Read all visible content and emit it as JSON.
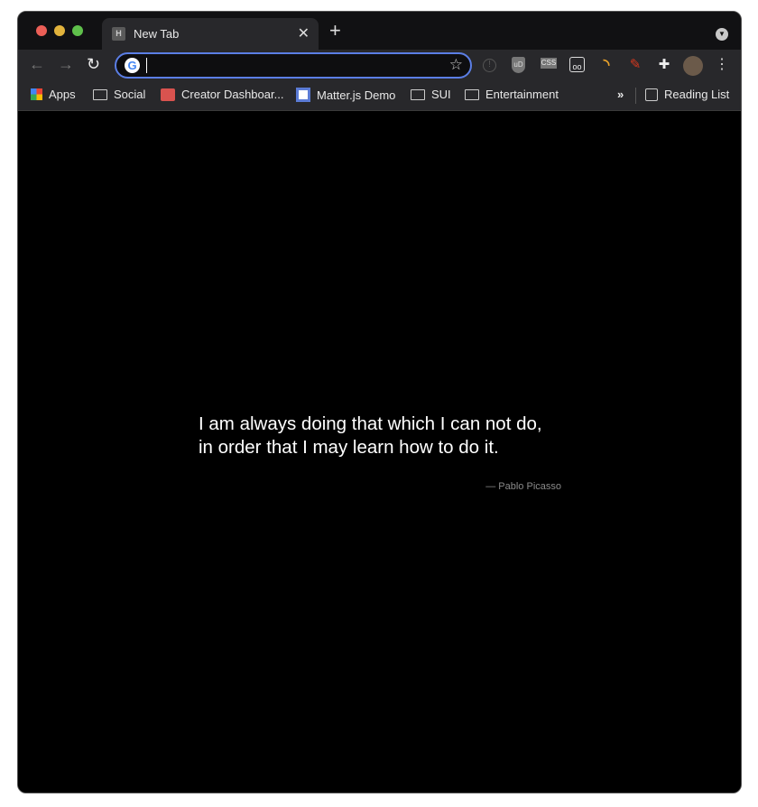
{
  "tab": {
    "favicon_letter": "H",
    "title": "New Tab"
  },
  "omnibox": {
    "value": ""
  },
  "bookmarks": [
    {
      "label": "Apps",
      "icon": "apps-grid-icon"
    },
    {
      "label": "Social",
      "icon": "folder-icon"
    },
    {
      "label": "Creator Dashboar...",
      "icon": "store-icon"
    },
    {
      "label": "Matter.js Demo",
      "icon": "brm-icon"
    },
    {
      "label": "SUI",
      "icon": "folder-icon"
    },
    {
      "label": "Entertainment",
      "icon": "folder-icon"
    }
  ],
  "reading_list": "Reading List",
  "overflow": "»",
  "extensions": {
    "ublock": "uD",
    "css": "CSS"
  },
  "quote": {
    "text": "I am always doing that which I can not do, in order that I may learn how to do it.",
    "author": "— Pablo Picasso"
  },
  "colors": {
    "accent": "#5b7ee5",
    "background": "#000000"
  }
}
